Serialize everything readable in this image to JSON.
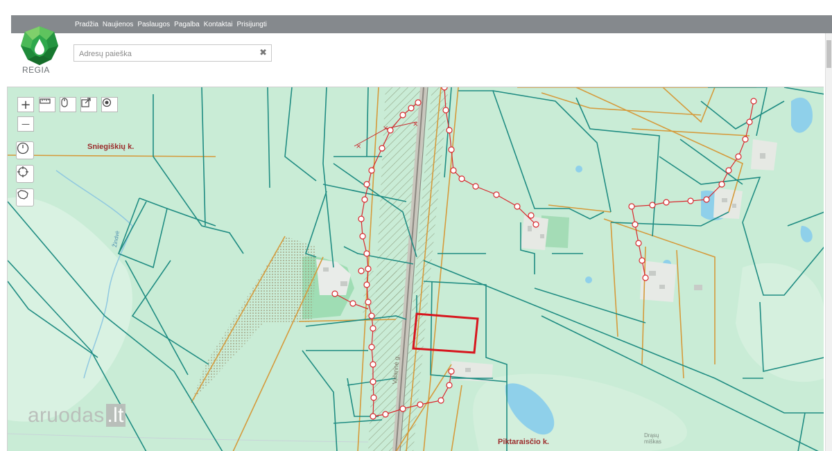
{
  "header": {
    "nav": [
      "Pradžia",
      "Naujienos",
      "Paslaugos",
      "Pagalba",
      "Kontaktai",
      "Prisijungti"
    ],
    "logo_text": "REGIA",
    "search_placeholder": "Adresų paieška",
    "search_clear": "✖"
  },
  "map": {
    "controls": {
      "zoom_in": "+",
      "zoom_out": "—"
    },
    "labels": {
      "village_1": "Sniegiškių k.",
      "village_2": "Piktaraisčio k.",
      "street": "Valarinė g.",
      "stream": "Žindvė",
      "forest": "Drąsų miškas"
    },
    "colors": {
      "background": "#c9ecd6",
      "parcel_teal": "#1f8c82",
      "boundary_orange": "#d59a3b",
      "route_red": "#d9262c",
      "selection_red": "#d7161e",
      "water": "#8fd0ea"
    }
  },
  "watermark": {
    "text": "aruodas",
    "domain": ".lt"
  }
}
